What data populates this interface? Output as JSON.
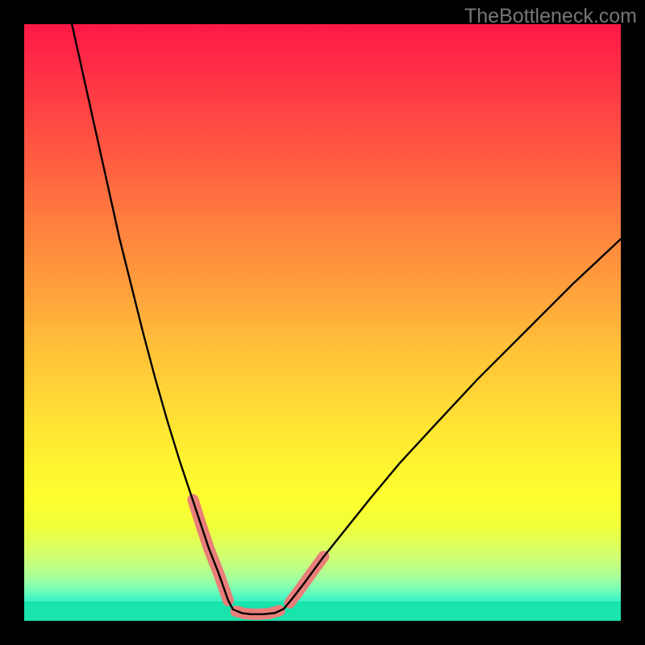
{
  "watermark": "TheBottleneck.com",
  "chart_data": {
    "type": "line",
    "title": "",
    "xlabel": "",
    "ylabel": "",
    "xlim": [
      0,
      100
    ],
    "ylim": [
      0,
      100
    ],
    "series": [
      {
        "name": "curve-left",
        "x": [
          8,
          10,
          12,
          14,
          16,
          18,
          20,
          22,
          24,
          26,
          28,
          29.5,
          31,
          32.5,
          33.5,
          34.2,
          35
        ],
        "y": [
          100,
          91,
          82,
          73,
          64,
          56,
          48,
          40.5,
          33.5,
          27,
          21,
          16.5,
          12,
          8.2,
          5.4,
          3.4,
          1.9
        ]
      },
      {
        "name": "flat-bottom",
        "x": [
          35,
          36.5,
          38,
          40,
          42,
          43.5
        ],
        "y": [
          1.9,
          1.3,
          1.1,
          1.1,
          1.3,
          2.0
        ]
      },
      {
        "name": "curve-right",
        "x": [
          43.5,
          45,
          47,
          50,
          54,
          58,
          63,
          69,
          76,
          84,
          92,
          100
        ],
        "y": [
          2.0,
          3.8,
          6.4,
          10.5,
          15.5,
          20.5,
          26.5,
          33,
          40.5,
          48.5,
          56.5,
          64
        ]
      }
    ],
    "highlight_segments": [
      {
        "name": "left-highlight",
        "x": [
          28.3,
          29.5,
          31,
          32.5,
          33.5,
          34.2
        ],
        "y": [
          20.3,
          16.5,
          12,
          8.2,
          5.4,
          3.4
        ]
      },
      {
        "name": "bottom-highlight",
        "x": [
          35.5,
          37,
          39,
          41,
          42.8
        ],
        "y": [
          1.6,
          1.2,
          1.1,
          1.2,
          1.7
        ]
      },
      {
        "name": "right-highlight",
        "x": [
          44.5,
          46,
          48,
          50.2
        ],
        "y": [
          3.0,
          5.0,
          7.8,
          10.8
        ]
      }
    ],
    "curve_style": {
      "stroke": "#000000",
      "width": 2.4
    },
    "highlight_style": {
      "stroke": "#e97e7a",
      "width": 14,
      "linecap": "round"
    }
  }
}
